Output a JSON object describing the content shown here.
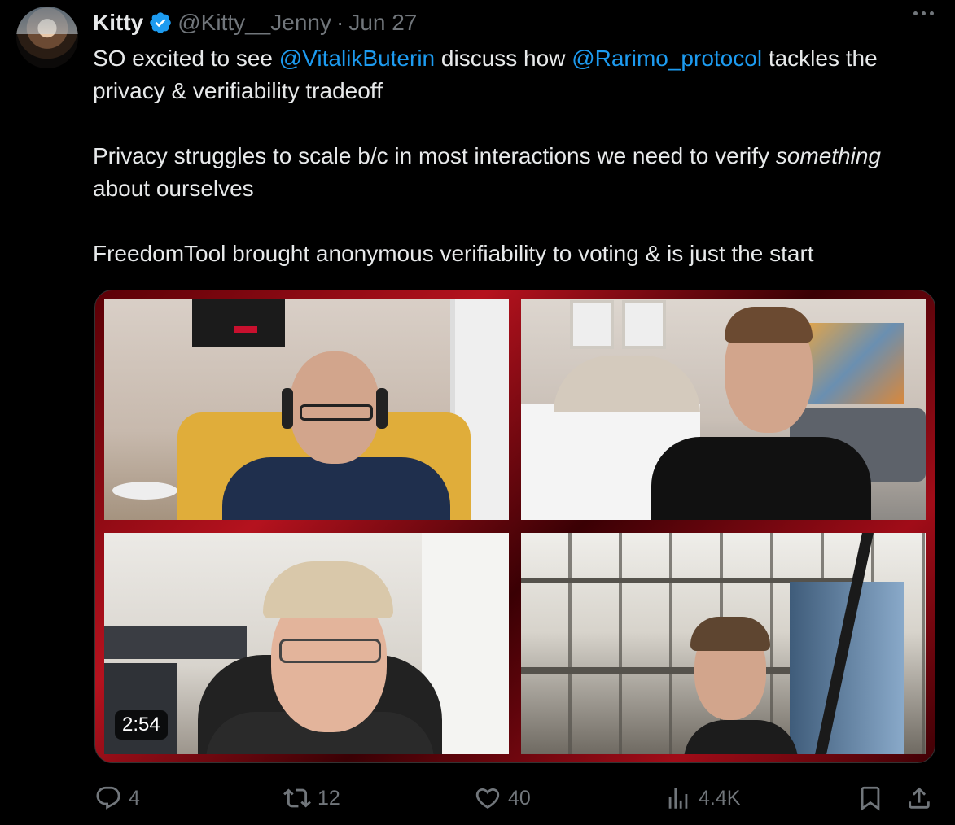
{
  "author": {
    "name": "Kitty",
    "handle": "@Kitty__Jenny",
    "separator": "·",
    "date": "Jun 27",
    "verified": true,
    "avatar_icon": "avatar"
  },
  "tweet": {
    "line1_pre": "SO excited to see ",
    "mention1": "@VitalikButerin",
    "line1_mid": " discuss how ",
    "mention2": "@Rarimo_protocol",
    "line1_post": " tackles the privacy & verifiability tradeoff",
    "para2_pre": "Privacy struggles to scale b/c in most interactions we need to verify ",
    "para2_ital": "something",
    "para2_post": " about ourselves",
    "para3": "FreedomTool brought anonymous verifiability to voting & is just the start"
  },
  "media": {
    "duration": "2:54",
    "frame_color": "#b5121e"
  },
  "actions": {
    "replies": "4",
    "reposts": "12",
    "likes": "40",
    "views": "4.4K"
  },
  "colors": {
    "background": "#000000",
    "text": "#e7e9ea",
    "muted": "#71767b",
    "accent": "#1d9bf0"
  }
}
